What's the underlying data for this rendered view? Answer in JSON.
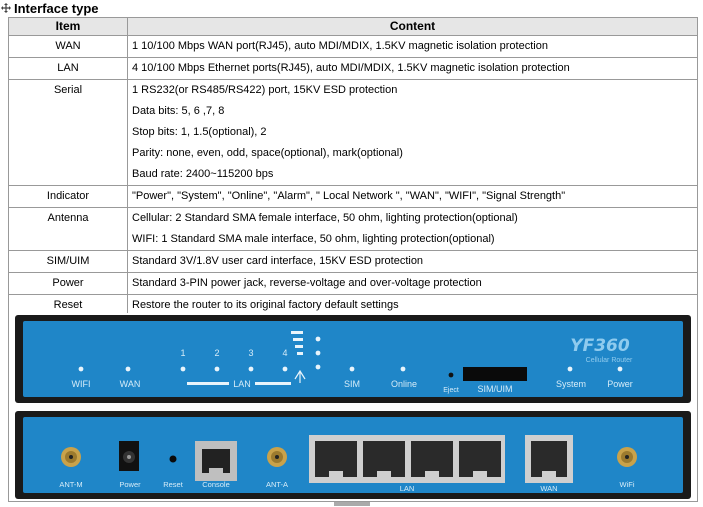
{
  "heading": "Interface type",
  "table": {
    "headers": [
      "Item",
      "Content"
    ],
    "rows": [
      {
        "item": "WAN",
        "lines": [
          "1 10/100 Mbps WAN port(RJ45), auto MDI/MDIX, 1.5KV magnetic isolation protection"
        ]
      },
      {
        "item": "LAN",
        "lines": [
          "4 10/100 Mbps Ethernet ports(RJ45), auto MDI/MDIX, 1.5KV magnetic isolation protection"
        ]
      },
      {
        "item": "Serial",
        "lines": [
          "1 RS232(or RS485/RS422) port, 15KV ESD protection",
          "Data bits: 5, 6 ,7, 8",
          "Stop bits: 1, 1.5(optional), 2",
          "Parity: none, even, odd, space(optional), mark(optional)",
          "Baud rate: 2400~115200 bps"
        ]
      },
      {
        "item": "Indicator",
        "lines": [
          "\"Power\", \"System\", \"Online\", \"Alarm\", \" Local Network \", \"WAN\", \"WIFI\", \"Signal Strength\""
        ]
      },
      {
        "item": "Antenna",
        "lines": [
          "Cellular: 2 Standard SMA female interface, 50 ohm, lighting protection(optional)",
          "WIFI: 1 Standard SMA male interface, 50 ohm, lighting protection(optional)"
        ]
      },
      {
        "item": "SIM/UIM",
        "lines": [
          "Standard 3V/1.8V user card interface, 15KV ESD protection"
        ]
      },
      {
        "item": "Power",
        "lines": [
          "Standard 3-PIN power jack, reverse-voltage and over-voltage protection"
        ]
      },
      {
        "item": "Reset",
        "lines": [
          "Restore the router to its original factory default settings"
        ]
      }
    ]
  },
  "device": {
    "front": {
      "brand": "YF360",
      "subtitle": "Cellular Router",
      "lan_numbers": [
        "1",
        "2",
        "3",
        "4"
      ],
      "labels": {
        "wifi": "WIFI",
        "wan": "WAN",
        "lan": "LAN",
        "sim": "SIM",
        "online": "Online",
        "eject": "Eject",
        "simuim": "SIM/UIM",
        "system": "System",
        "power": "Power"
      }
    },
    "rear": {
      "labels": {
        "antm": "ANT-M",
        "power": "Power",
        "reset": "Reset",
        "console": "Console",
        "anta": "ANT-A",
        "lan": "LAN",
        "wan": "WAN",
        "wifi": "WiFi"
      }
    },
    "colors": {
      "panel": "#1f86c8",
      "panel_dark": "#0f5f96",
      "chassis": "#1b1b1b",
      "port": "#d8d8d8",
      "label": "#d6ecf8"
    }
  }
}
